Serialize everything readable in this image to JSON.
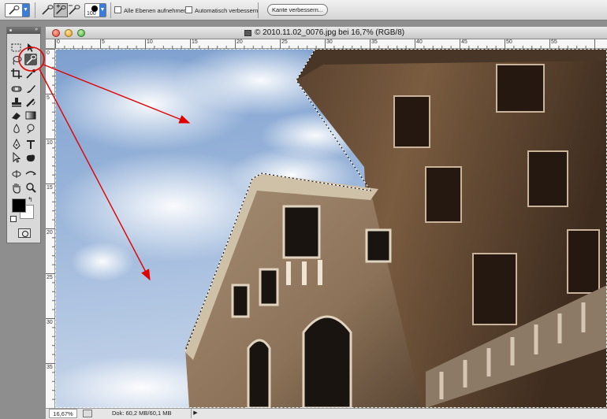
{
  "options_bar": {
    "brush_size": "100",
    "sample_all_layers_label": "Alle Ebenen aufnehmen",
    "auto_enhance_label": "Automatisch verbessern",
    "refine_edge_button": "Kante verbessern..."
  },
  "tools_panel": {
    "tools": [
      "rectangular-marquee",
      "move",
      "lasso",
      "quick-selection",
      "crop",
      "eyedropper",
      "spot-healing-brush",
      "brush",
      "clone-stamp",
      "history-brush",
      "eraser",
      "gradient",
      "blur",
      "dodge",
      "pen",
      "type",
      "path-selection",
      "custom-shape",
      "3d-rotate",
      "3d-orbit",
      "hand",
      "zoom"
    ],
    "active_tool": "quick-selection",
    "foreground_color": "#000000",
    "background_color": "#ffffff"
  },
  "document": {
    "title": "© 2010.11.02_0076.jpg bei 16,7% (RGB/8)",
    "ruler_top_labels": [
      "0",
      "5",
      "10",
      "15",
      "20",
      "25",
      "30",
      "35",
      "40",
      "45",
      "50",
      "55"
    ],
    "ruler_left_labels": [
      "0",
      "5",
      "10",
      "15",
      "20",
      "25",
      "30",
      "35"
    ],
    "status_zoom": "16,67%",
    "status_doc_info": "Dok: 60,2 MB/60,1 MB"
  },
  "annotation": {
    "color": "#e00000"
  }
}
